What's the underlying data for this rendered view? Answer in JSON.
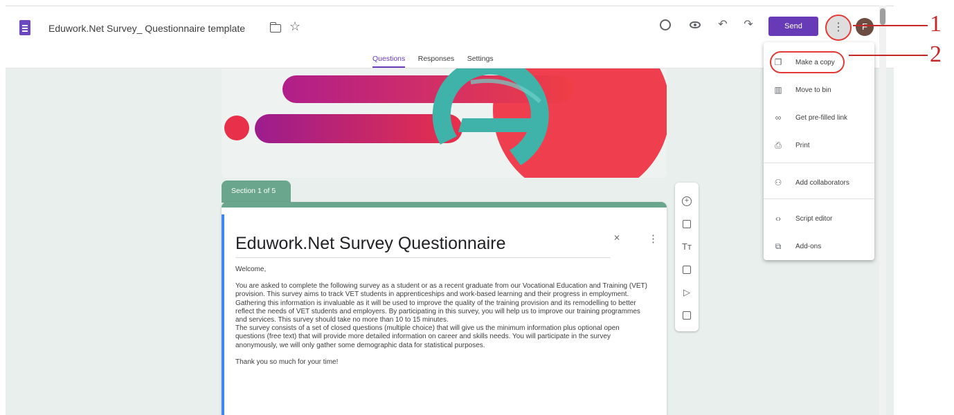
{
  "document": {
    "title": "Eduwork.Net Survey_ Questionnaire template"
  },
  "header": {
    "send_label": "Send",
    "more_label": "⋮",
    "avatar_letter": "F"
  },
  "tabs": [
    {
      "label": "Questions",
      "active": true
    },
    {
      "label": "Responses",
      "active": false
    },
    {
      "label": "Settings",
      "active": false
    }
  ],
  "section": {
    "label": "Section 1 of 5"
  },
  "form": {
    "title": "Eduwork.Net Survey Questionnaire",
    "body": [
      "Welcome,",
      "",
      "You are asked to complete the following survey as a student or as a recent graduate from our Vocational Education and Training (VET) provision. This survey aims to track VET students in apprenticeships and work-based learning and their progress in employment. Gathering this information is invaluable as it will be used to improve the quality of the training provision and its remodelling to better reflect the needs of VET students and employers. By participating in this survey, you will help us to improve our training programmes and services. This survey should take no more than 10 to 15 minutes.",
      "The survey consists of a set of closed questions (multiple choice) that will give us the minimum information plus optional open questions (free text) that will provide more detailed information on career and skills needs. You will participate in the survey anonymously, we will only gather some demographic data for statistical purposes.",
      "",
      "Thank you so much for your time!"
    ]
  },
  "menu": {
    "items": [
      {
        "label": "Make a copy",
        "icon": "copy-icon"
      },
      {
        "label": "Move to bin",
        "icon": "bin-icon"
      },
      {
        "label": "Get pre-filled link",
        "icon": "link-icon"
      },
      {
        "label": "Print",
        "icon": "print-icon"
      },
      {
        "label": "Add collaborators",
        "icon": "add-people-icon"
      },
      {
        "label": "Script editor",
        "icon": "code-icon"
      },
      {
        "label": "Add-ons",
        "icon": "puzzle-icon"
      }
    ]
  },
  "callouts": [
    "1",
    "2"
  ],
  "colors": {
    "accent": "#673ab7",
    "section": "#6aa68e",
    "callout": "#c62828",
    "highlight": "#e53935"
  }
}
